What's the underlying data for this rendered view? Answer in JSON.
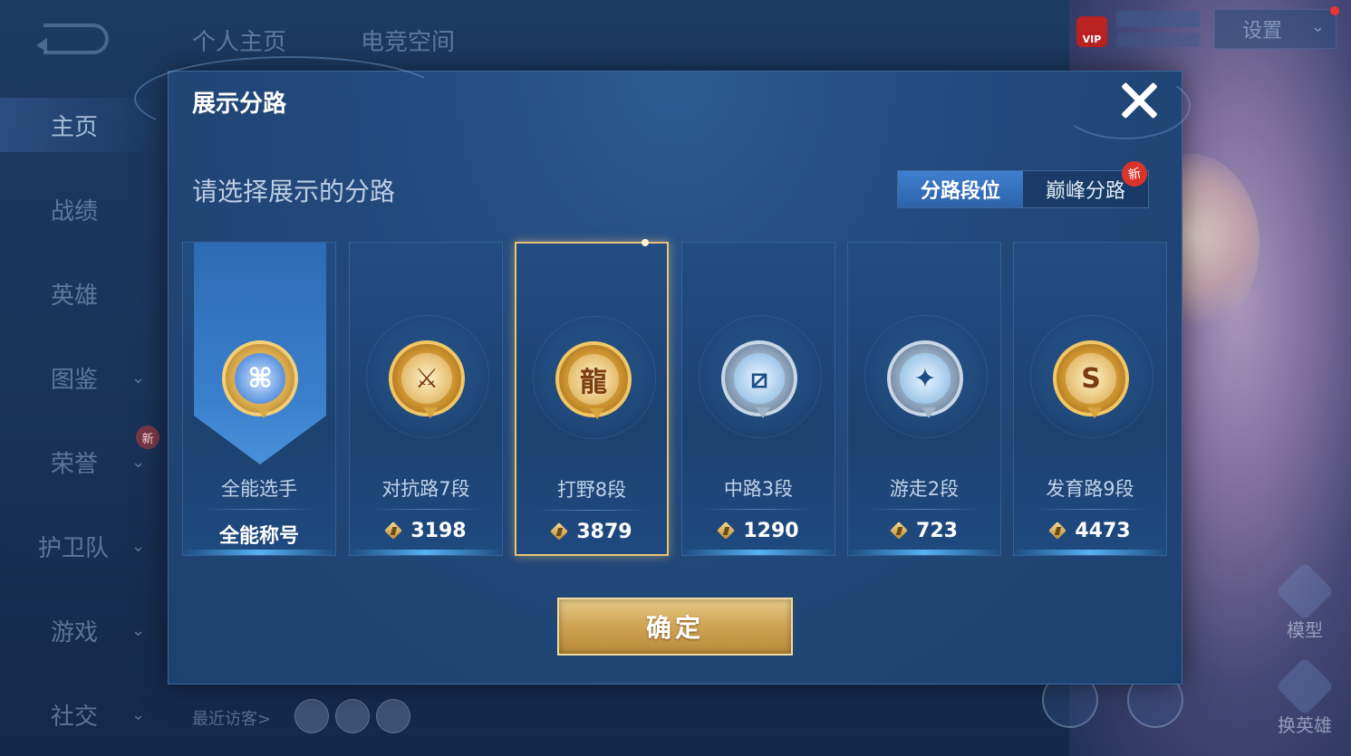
{
  "header": {
    "tabs": [
      "个人主页",
      "电竞空间"
    ],
    "settings_label": "设置",
    "vip_label": "VIP"
  },
  "sidebar": {
    "items": [
      {
        "label": "主页",
        "expandable": false,
        "active": true
      },
      {
        "label": "战绩",
        "expandable": false
      },
      {
        "label": "英雄",
        "expandable": false
      },
      {
        "label": "图鉴",
        "expandable": true
      },
      {
        "label": "荣誉",
        "expandable": true
      },
      {
        "label": "护卫队",
        "expandable": true
      },
      {
        "label": "游戏",
        "expandable": true
      },
      {
        "label": "社交",
        "expandable": true
      }
    ],
    "new_badge": "新"
  },
  "recent_visitors_label": "最近访客>",
  "right_buttons": {
    "model": "模型",
    "switch_hero": "换英雄"
  },
  "modal": {
    "title": "展示分路",
    "subtitle": "请选择展示的分路",
    "segments": [
      {
        "label": "分路段位",
        "active": true
      },
      {
        "label": "巅峰分路",
        "active": false
      }
    ],
    "new_badge": "新",
    "cards": [
      {
        "icon": "all-round-badge-icon",
        "role": "全能选手",
        "score": "全能称号",
        "has_peak_icon": false,
        "selected": false
      },
      {
        "icon": "clash-lane-badge-icon",
        "role": "对抗路7段",
        "score": "3198",
        "has_peak_icon": true,
        "selected": false
      },
      {
        "icon": "jungle-badge-icon",
        "role": "打野8段",
        "score": "3879",
        "has_peak_icon": true,
        "selected": true
      },
      {
        "icon": "mid-lane-badge-icon",
        "role": "中路3段",
        "score": "1290",
        "has_peak_icon": true,
        "selected": false
      },
      {
        "icon": "roam-badge-icon",
        "role": "游走2段",
        "score": "723",
        "has_peak_icon": true,
        "selected": false
      },
      {
        "icon": "farm-lane-badge-icon",
        "role": "发育路9段",
        "score": "4473",
        "has_peak_icon": true,
        "selected": false
      }
    ],
    "confirm_label": "确定"
  },
  "colors": {
    "accent_gold": "#e8c27a",
    "panel_blue": "#234a7c",
    "segment_active": "#3f7fcf",
    "new_badge_red": "#d9342b"
  }
}
